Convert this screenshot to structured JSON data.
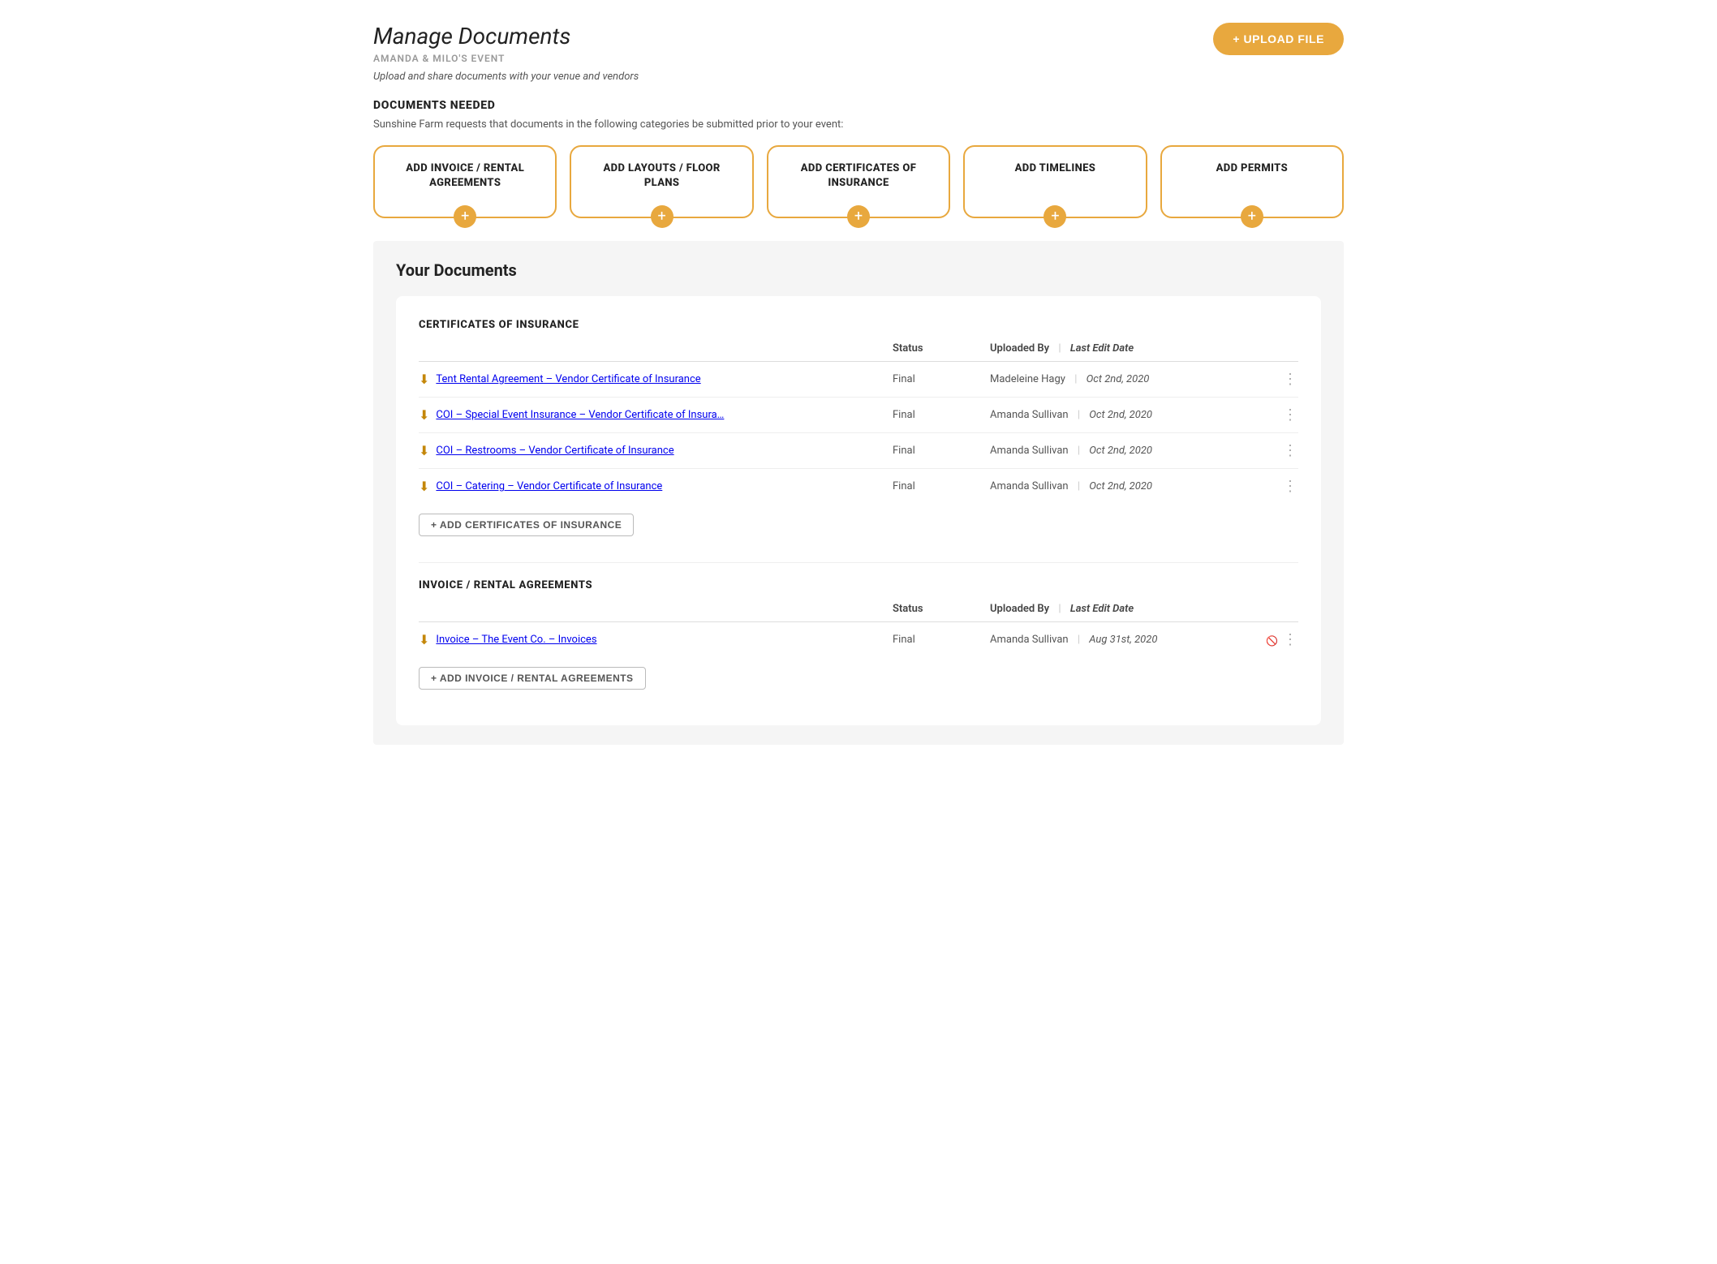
{
  "page": {
    "title": "Manage Documents",
    "event_name": "AMANDA & MILO'S EVENT",
    "description": "Upload and share documents with your venue and vendors"
  },
  "upload_button": {
    "label": "+ UPLOAD FILE"
  },
  "documents_needed": {
    "heading": "DOCUMENTS NEEDED",
    "subheading": "Sunshine Farm requests that documents in the following categories be submitted prior to your event:",
    "cards": [
      {
        "id": "invoice-rental",
        "label": "ADD INVOICE / RENTAL AGREEMENTS"
      },
      {
        "id": "layouts-floor",
        "label": "ADD LAYOUTS / FLOOR PLANS"
      },
      {
        "id": "certificates",
        "label": "ADD CERTIFICATES OF INSURANCE"
      },
      {
        "id": "timelines",
        "label": "ADD TIMELINES"
      },
      {
        "id": "permits",
        "label": "ADD PERMITS"
      }
    ]
  },
  "your_documents": {
    "title": "Your Documents",
    "sections": [
      {
        "id": "certificates-of-insurance",
        "heading": "CERTIFICATES OF INSURANCE",
        "col_status": "Status",
        "col_uploaded": "Uploaded By",
        "col_date": "Last Edit Date",
        "rows": [
          {
            "name": "Tent Rental Agreement – Vendor Certificate of Insurance",
            "status": "Final",
            "uploaded_by": "Madeleine Hagy",
            "date": "Oct 2nd, 2020",
            "has_eye": false
          },
          {
            "name": "COI – Special Event Insurance – Vendor Certificate of Insura…",
            "status": "Final",
            "uploaded_by": "Amanda Sullivan",
            "date": "Oct 2nd, 2020",
            "has_eye": false
          },
          {
            "name": "COI – Restrooms – Vendor Certificate of Insurance",
            "status": "Final",
            "uploaded_by": "Amanda Sullivan",
            "date": "Oct 2nd, 2020",
            "has_eye": false
          },
          {
            "name": "COI – Catering – Vendor Certificate of Insurance",
            "status": "Final",
            "uploaded_by": "Amanda Sullivan",
            "date": "Oct 2nd, 2020",
            "has_eye": false
          }
        ],
        "add_button_label": "+ ADD CERTIFICATES OF INSURANCE"
      },
      {
        "id": "invoice-rental-agreements",
        "heading": "INVOICE / RENTAL AGREEMENTS",
        "col_status": "Status",
        "col_uploaded": "Uploaded By",
        "col_date": "Last Edit Date",
        "rows": [
          {
            "name": "Invoice – The Event Co. – Invoices",
            "status": "Final",
            "uploaded_by": "Amanda Sullivan",
            "date": "Aug 31st, 2020",
            "has_eye": true
          }
        ],
        "add_button_label": "+ ADD INVOICE / RENTAL AGREEMENTS"
      }
    ]
  },
  "icons": {
    "download": "⬇",
    "dots": "⋮",
    "plus": "+",
    "eye_slash": "⊘"
  }
}
